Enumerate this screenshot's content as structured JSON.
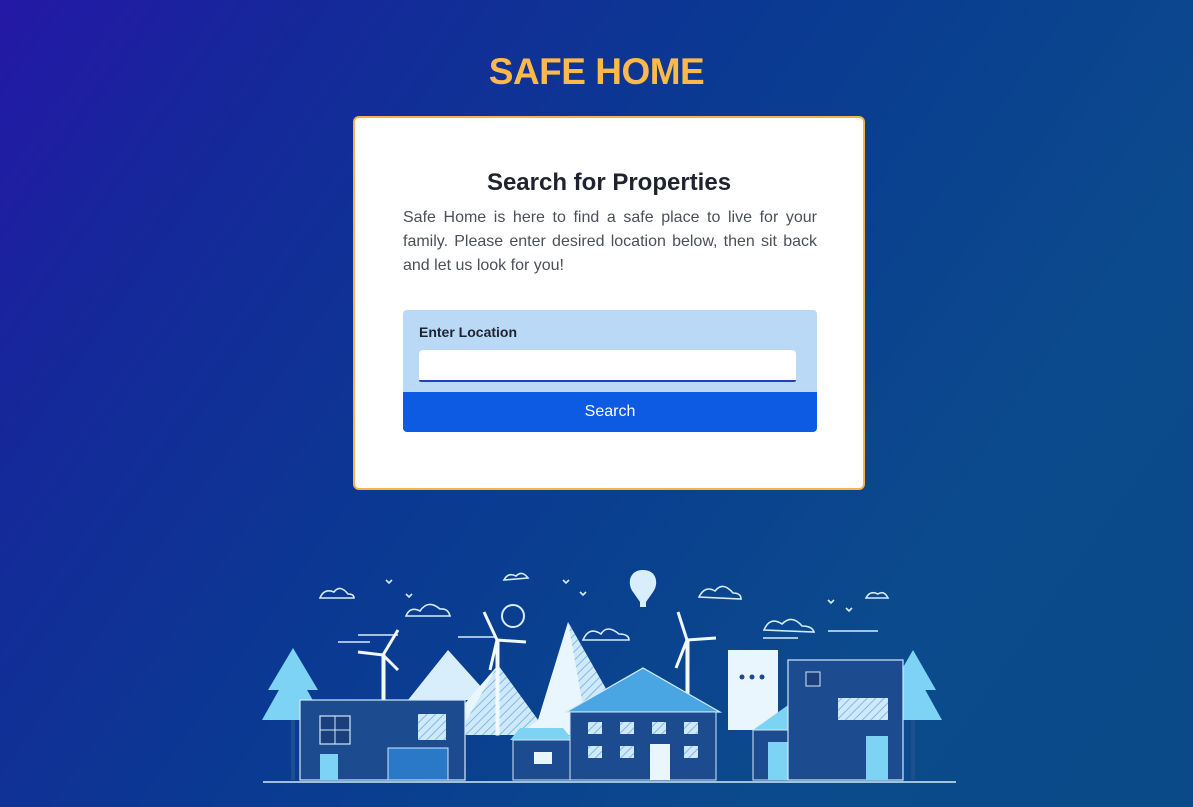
{
  "header": {
    "title": "SAFE HOME"
  },
  "search_card": {
    "title": "Search for Properties",
    "description": "Safe Home is here to find a safe place to live for your family. Please enter desired location below, then sit back and let us look for you!",
    "location_label": "Enter Location",
    "location_value": "",
    "location_placeholder": "",
    "search_button_label": "Search"
  },
  "colors": {
    "brand_accent": "#ffb94a",
    "primary_button": "#0d5be3",
    "panel_background": "#b9d9f7",
    "background_start": "#2418a6",
    "background_end": "#0a4a88"
  },
  "illustration": {
    "icon": "town-illustration"
  }
}
